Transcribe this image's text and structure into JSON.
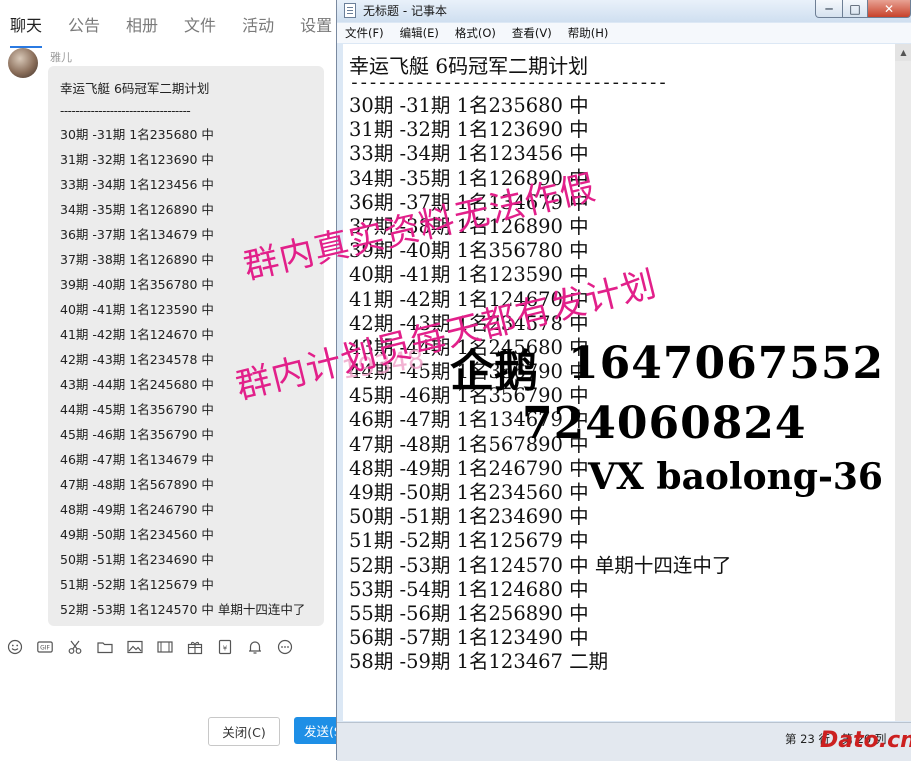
{
  "chat": {
    "tabs": [
      "聊天",
      "公告",
      "相册",
      "文件",
      "活动",
      "设置"
    ],
    "active_tab": 0,
    "sender": "雅儿",
    "message": {
      "title": "幸运飞艇 6码冠军二期计划",
      "separator": "----------------------------------",
      "lines": [
        "30期 -31期 1名235680 中",
        "31期 -32期 1名123690 中",
        "33期 -34期 1名123456 中",
        "34期 -35期 1名126890 中",
        "36期 -37期 1名134679 中",
        "37期 -38期 1名126890 中",
        "39期 -40期 1名356780 中",
        "40期 -41期 1名123590 中",
        "41期 -42期 1名124670 中",
        "42期 -43期 1名234578 中",
        "43期 -44期 1名245680 中",
        "44期 -45期 1名356790 中",
        "45期 -46期 1名356790 中",
        "46期 -47期 1名134679 中",
        "47期 -48期 1名567890 中",
        "48期 -49期 1名246790 中",
        "49期 -50期 1名234560 中",
        "50期 -51期 1名234690 中",
        "51期 -52期 1名125679 中",
        "52期 -53期 1名124570 中 单期十四连中了"
      ]
    },
    "toolbar_icons": [
      "emoji-icon",
      "gif-icon",
      "scissors-icon",
      "folder-icon",
      "image-icon",
      "media-icon",
      "gift-icon",
      "red-packet-icon",
      "bell-icon",
      "more-icon"
    ],
    "toolbar_glyphs": {
      "gif": "GIF",
      "yen": "¥"
    },
    "close_label": "关闭(C)",
    "send_label": "发送(S"
  },
  "notepad": {
    "window_title": "无标题 - 记事本",
    "controls": {
      "minimize": "─",
      "maximize": "□",
      "close": "✕"
    },
    "menu": [
      "文件(F)",
      "编辑(E)",
      "格式(O)",
      "查看(V)",
      "帮助(H)"
    ],
    "title_line": "幸运飞艇 6码冠军二期计划",
    "separator": "----------------------------------",
    "lines": [
      "30期 -31期 1名235680 中",
      "31期 -32期 1名123690 中",
      "33期 -34期 1名123456 中",
      "34期 -35期 1名126890 中",
      "36期 -37期 1名134679 中",
      "37期 -38期 1名126890 中",
      "39期 -40期 1名356780 中",
      "40期 -41期 1名123590 中",
      "41期 -42期 1名124670 中",
      "42期 -43期 1名234578 中",
      "43期 -44期 1名245680 中",
      "44期 -45期 1名356790 中",
      "45期 -46期 1名356790 中",
      "46期 -47期 1名134679 中",
      "47期 -48期 1名567890 中",
      "48期 -49期 1名246790 中",
      "49期 -50期 1名234560 中",
      "50期 -51期 1名234690 中",
      "51期 -52期 1名125679 中",
      "52期 -53期 1名124570 中  单期十四连中了",
      "53期 -54期 1名124680 中",
      "55期 -56期 1名256890 中",
      "56期 -57期 1名123490 中",
      "58期 -59期 1名123467 二期"
    ],
    "status": "第 23 行，第 20 列"
  },
  "overlay": {
    "watermark1": "群内真实资料无法作假",
    "watermark2": "群内计划员每天都有发计划",
    "watermark_faint": "19348",
    "contact_qq_label": "企鹅",
    "contact_qq1": "1647067552",
    "contact_qq2": "724060824",
    "contact_vx": "VX baolong-36",
    "site_logo": "Dato.cn"
  },
  "colors": {
    "watermark": "#e2208a",
    "send_button": "#1e8fe6",
    "bubble": "#ececec",
    "window_frame": "#dce8f5",
    "close_button": "#c7422a"
  }
}
